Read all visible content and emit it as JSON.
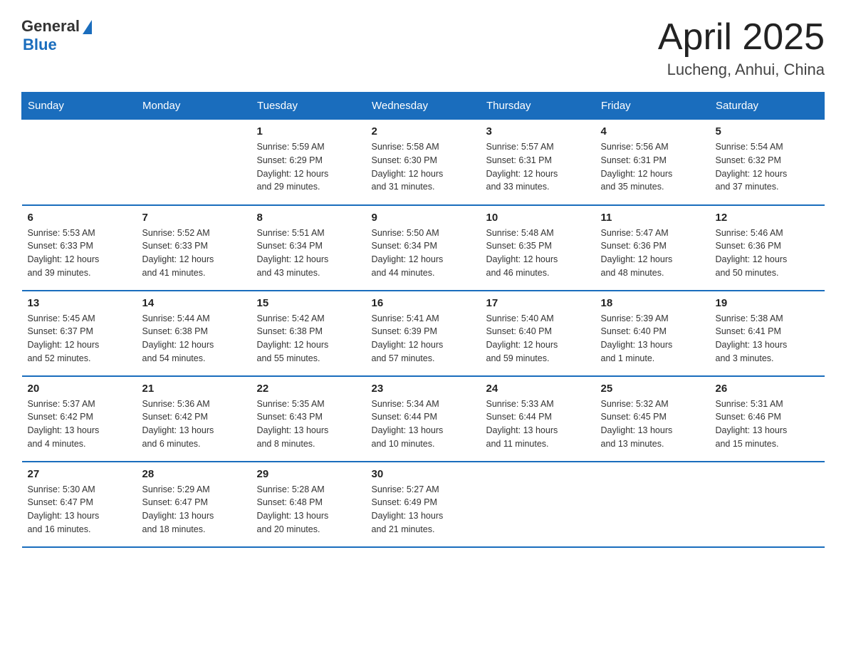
{
  "logo": {
    "general": "General",
    "blue": "Blue",
    "triangle": "▶"
  },
  "header": {
    "month": "April 2025",
    "location": "Lucheng, Anhui, China"
  },
  "weekdays": [
    "Sunday",
    "Monday",
    "Tuesday",
    "Wednesday",
    "Thursday",
    "Friday",
    "Saturday"
  ],
  "weeks": [
    [
      {
        "day": "",
        "info": ""
      },
      {
        "day": "",
        "info": ""
      },
      {
        "day": "1",
        "info": "Sunrise: 5:59 AM\nSunset: 6:29 PM\nDaylight: 12 hours\nand 29 minutes."
      },
      {
        "day": "2",
        "info": "Sunrise: 5:58 AM\nSunset: 6:30 PM\nDaylight: 12 hours\nand 31 minutes."
      },
      {
        "day": "3",
        "info": "Sunrise: 5:57 AM\nSunset: 6:31 PM\nDaylight: 12 hours\nand 33 minutes."
      },
      {
        "day": "4",
        "info": "Sunrise: 5:56 AM\nSunset: 6:31 PM\nDaylight: 12 hours\nand 35 minutes."
      },
      {
        "day": "5",
        "info": "Sunrise: 5:54 AM\nSunset: 6:32 PM\nDaylight: 12 hours\nand 37 minutes."
      }
    ],
    [
      {
        "day": "6",
        "info": "Sunrise: 5:53 AM\nSunset: 6:33 PM\nDaylight: 12 hours\nand 39 minutes."
      },
      {
        "day": "7",
        "info": "Sunrise: 5:52 AM\nSunset: 6:33 PM\nDaylight: 12 hours\nand 41 minutes."
      },
      {
        "day": "8",
        "info": "Sunrise: 5:51 AM\nSunset: 6:34 PM\nDaylight: 12 hours\nand 43 minutes."
      },
      {
        "day": "9",
        "info": "Sunrise: 5:50 AM\nSunset: 6:34 PM\nDaylight: 12 hours\nand 44 minutes."
      },
      {
        "day": "10",
        "info": "Sunrise: 5:48 AM\nSunset: 6:35 PM\nDaylight: 12 hours\nand 46 minutes."
      },
      {
        "day": "11",
        "info": "Sunrise: 5:47 AM\nSunset: 6:36 PM\nDaylight: 12 hours\nand 48 minutes."
      },
      {
        "day": "12",
        "info": "Sunrise: 5:46 AM\nSunset: 6:36 PM\nDaylight: 12 hours\nand 50 minutes."
      }
    ],
    [
      {
        "day": "13",
        "info": "Sunrise: 5:45 AM\nSunset: 6:37 PM\nDaylight: 12 hours\nand 52 minutes."
      },
      {
        "day": "14",
        "info": "Sunrise: 5:44 AM\nSunset: 6:38 PM\nDaylight: 12 hours\nand 54 minutes."
      },
      {
        "day": "15",
        "info": "Sunrise: 5:42 AM\nSunset: 6:38 PM\nDaylight: 12 hours\nand 55 minutes."
      },
      {
        "day": "16",
        "info": "Sunrise: 5:41 AM\nSunset: 6:39 PM\nDaylight: 12 hours\nand 57 minutes."
      },
      {
        "day": "17",
        "info": "Sunrise: 5:40 AM\nSunset: 6:40 PM\nDaylight: 12 hours\nand 59 minutes."
      },
      {
        "day": "18",
        "info": "Sunrise: 5:39 AM\nSunset: 6:40 PM\nDaylight: 13 hours\nand 1 minute."
      },
      {
        "day": "19",
        "info": "Sunrise: 5:38 AM\nSunset: 6:41 PM\nDaylight: 13 hours\nand 3 minutes."
      }
    ],
    [
      {
        "day": "20",
        "info": "Sunrise: 5:37 AM\nSunset: 6:42 PM\nDaylight: 13 hours\nand 4 minutes."
      },
      {
        "day": "21",
        "info": "Sunrise: 5:36 AM\nSunset: 6:42 PM\nDaylight: 13 hours\nand 6 minutes."
      },
      {
        "day": "22",
        "info": "Sunrise: 5:35 AM\nSunset: 6:43 PM\nDaylight: 13 hours\nand 8 minutes."
      },
      {
        "day": "23",
        "info": "Sunrise: 5:34 AM\nSunset: 6:44 PM\nDaylight: 13 hours\nand 10 minutes."
      },
      {
        "day": "24",
        "info": "Sunrise: 5:33 AM\nSunset: 6:44 PM\nDaylight: 13 hours\nand 11 minutes."
      },
      {
        "day": "25",
        "info": "Sunrise: 5:32 AM\nSunset: 6:45 PM\nDaylight: 13 hours\nand 13 minutes."
      },
      {
        "day": "26",
        "info": "Sunrise: 5:31 AM\nSunset: 6:46 PM\nDaylight: 13 hours\nand 15 minutes."
      }
    ],
    [
      {
        "day": "27",
        "info": "Sunrise: 5:30 AM\nSunset: 6:47 PM\nDaylight: 13 hours\nand 16 minutes."
      },
      {
        "day": "28",
        "info": "Sunrise: 5:29 AM\nSunset: 6:47 PM\nDaylight: 13 hours\nand 18 minutes."
      },
      {
        "day": "29",
        "info": "Sunrise: 5:28 AM\nSunset: 6:48 PM\nDaylight: 13 hours\nand 20 minutes."
      },
      {
        "day": "30",
        "info": "Sunrise: 5:27 AM\nSunset: 6:49 PM\nDaylight: 13 hours\nand 21 minutes."
      },
      {
        "day": "",
        "info": ""
      },
      {
        "day": "",
        "info": ""
      },
      {
        "day": "",
        "info": ""
      }
    ]
  ]
}
